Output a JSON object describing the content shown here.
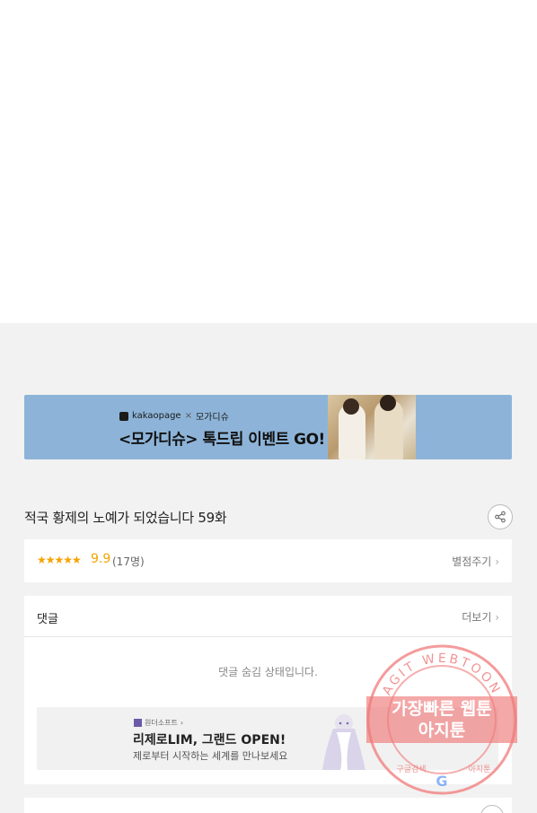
{
  "banner": {
    "brand": "kakaopage",
    "partner": "모가디슈",
    "times": "×",
    "headline": "<모가디슈> 톡드립 이벤트 GO!"
  },
  "episode": {
    "title": "적국 황제의 노예가 되었습니다 59화"
  },
  "rating": {
    "stars": "★★★★★",
    "score": "9.9",
    "count": "(17명)",
    "rate_link": "별점주기"
  },
  "comments": {
    "label": "댓글",
    "more": "더보기",
    "hidden_message": "댓글 숨김 상태입니다."
  },
  "ad": {
    "brand": "원더소프트",
    "title": "리제로LIM, 그랜드 OPEN!",
    "subtitle": "제로부터 시작하는 세계를 만나보세요"
  },
  "watermark": {
    "ring_text": "AGIT WEBTOON",
    "line1": "가장빠른 웹툰",
    "line2": "아지툰",
    "bottom_left": "구글검색",
    "bottom_right": "아지툰"
  },
  "colors": {
    "banner_bg": "#8db4d8",
    "star": "#f5a300",
    "watermark": "#f07a7a"
  },
  "icons": {
    "share": "share-icon",
    "chevron": "chevron-right-icon"
  }
}
